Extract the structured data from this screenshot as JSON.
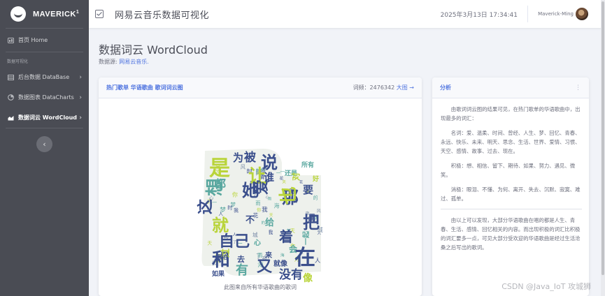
{
  "brand": {
    "name": "MAVERICK",
    "sup": "1"
  },
  "sidebar": {
    "home": "首页 Home",
    "section_heading": "数据可视化",
    "items": [
      {
        "label": "后台数据 DataBase"
      },
      {
        "label": "数据图表 DataCharts"
      },
      {
        "label": "数据词云 WordCloud"
      }
    ]
  },
  "topbar": {
    "title": "网易云音乐数据可视化",
    "datetime": "2025年3月13日 17:34:41",
    "username": "Maverick-Ming"
  },
  "page": {
    "title": "数据词云 WordCloud",
    "source_label": "数据源: ",
    "source_link": "网易云音乐."
  },
  "wordcloud_card": {
    "title": "热门歌单 华语歌曲 歌词词云图",
    "freq_label": "词频：2476342",
    "big_link": "大图 →",
    "caption": "此图来自所有华语歌曲的歌词",
    "words": [
      {
        "t": "是",
        "c": "#b9d43a"
      },
      {
        "t": "说",
        "c": "#3b4f8c"
      },
      {
        "t": "被",
        "c": "#3b4f8c"
      },
      {
        "t": "为",
        "c": "#3b4f8c"
      },
      {
        "t": "让",
        "c": "#b9d43a"
      },
      {
        "t": "都",
        "c": "#5aa8a0"
      },
      {
        "t": "想",
        "c": "#5aa8a0"
      },
      {
        "t": "她",
        "c": "#3b4f8c"
      },
      {
        "t": "爱",
        "c": "#3b4f8c"
      },
      {
        "t": "谁",
        "c": "#3b4f8c"
      },
      {
        "t": "这",
        "c": "#3b4f8c"
      },
      {
        "t": "那",
        "c": "#3b4f8c"
      },
      {
        "t": "也",
        "c": "#b9d43a"
      },
      {
        "t": "要",
        "c": "#3b4f8c"
      },
      {
        "t": "就",
        "c": "#b9d43a"
      },
      {
        "t": "不",
        "c": "#3b4f8c"
      },
      {
        "t": "给",
        "c": "#5aa8a0"
      },
      {
        "t": "把",
        "c": "#3b4f8c"
      },
      {
        "t": "自己",
        "c": "#3b4f8c"
      },
      {
        "t": "着",
        "c": "#3b4f8c"
      },
      {
        "t": "和",
        "c": "#3b4f8c"
      },
      {
        "t": "在",
        "c": "#3b4f8c"
      },
      {
        "t": "又",
        "c": "#3b4f8c"
      },
      {
        "t": "有",
        "c": "#5aa8a0"
      },
      {
        "t": "没有",
        "c": "#3b4f8c"
      },
      {
        "t": "像",
        "c": "#b9d43a"
      },
      {
        "t": "会",
        "c": "#5aa8a0"
      },
      {
        "t": "去",
        "c": "#3b4f8c"
      },
      {
        "t": "过",
        "c": "#b9d43a"
      },
      {
        "t": "还是",
        "c": "#5aa8a0"
      },
      {
        "t": "好",
        "c": "#b9d43a"
      },
      {
        "t": "对",
        "c": "#b9d43a"
      },
      {
        "t": "里",
        "c": "#3b4f8c"
      },
      {
        "t": "所有",
        "c": "#5aa8a0"
      },
      {
        "t": "现在",
        "c": "#3b4f8c"
      },
      {
        "t": "如果",
        "c": "#3b4f8c"
      },
      {
        "t": "心",
        "c": "#5aa8a0"
      },
      {
        "t": "来",
        "c": "#3b4f8c"
      },
      {
        "t": "就像",
        "c": "#3b4f8c"
      },
      {
        "t": "一起",
        "c": "#5aa8a0"
      }
    ]
  },
  "analysis": {
    "title": "分析",
    "p1": "由歌词词云图的结果可见，在热门歌单的华语歌曲中，出现最多的词汇：",
    "p2": "名词：爱、温柔、时间、曾经、人生、梦、回忆、青春、永远、快乐、未来、明天、思念、生活、世界、爱情、习惯、天空、感情、故事、过去、现在。",
    "p3": "积极：想、相信、留下、期待、如果、努力、遇见、微笑。",
    "p4": "消极：眼泪、不懂、为何、离开、失去、沉默、寂寞、难过、孤单。",
    "p5": "由以上可以发现，大部分华语歌曲在唱的都是人生、青春、生活、感情、回忆相关的内容。而出现积极的词汇比积极的词汇要多一点，可见大部分受欢迎的华语歌曲是经过生活沧桑之后写出的歌词。"
  },
  "watermark": "CSDN @Java_IoT 攻城狮",
  "colors": {
    "sidebar": "#4a4c54",
    "accent": "#4e73df",
    "background": "#f1f3f8"
  }
}
